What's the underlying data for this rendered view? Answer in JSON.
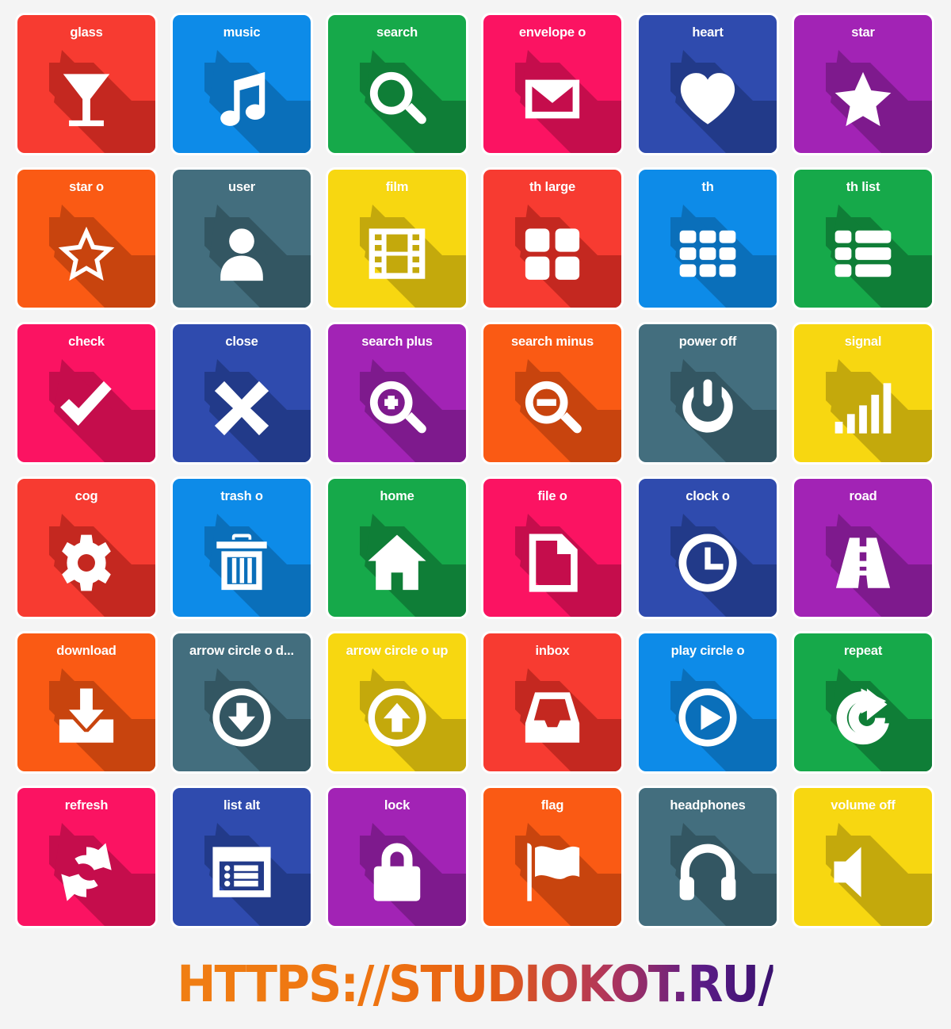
{
  "page": {
    "background": "#f4f4f4",
    "columns": 6,
    "rows": 6,
    "tile_label_color": "#ffffff",
    "tile_icon_color": "#ffffff"
  },
  "footer": {
    "url_text": "HTTPS://STUDIOKOT.RU/",
    "gradient_start": "#F07E13",
    "gradient_end": "#3A1170"
  },
  "tiles": [
    {
      "label": "glass",
      "icon": "glass-icon",
      "color": "#F73B31",
      "shadow": "#C42820"
    },
    {
      "label": "music",
      "icon": "music-icon",
      "color": "#0D8BE8",
      "shadow": "#0A6FBA"
    },
    {
      "label": "search",
      "icon": "search-icon",
      "color": "#16A94A",
      "shadow": "#0F7E37"
    },
    {
      "label": "envelope o",
      "icon": "envelope-open-icon",
      "color": "#FB1362",
      "shadow": "#C50D4C"
    },
    {
      "label": "heart",
      "icon": "heart-icon",
      "color": "#2F4BAE",
      "shadow": "#223A89"
    },
    {
      "label": "star",
      "icon": "star-icon",
      "color": "#A223B5",
      "shadow": "#7E1A8D"
    },
    {
      "label": "star o",
      "icon": "star-outline-icon",
      "color": "#FA5A14",
      "shadow": "#C8440E"
    },
    {
      "label": "user",
      "icon": "user-icon",
      "color": "#436E7E",
      "shadow": "#335662"
    },
    {
      "label": "film",
      "icon": "film-icon",
      "color": "#F7D711",
      "shadow": "#C4A90C"
    },
    {
      "label": "th large",
      "icon": "th-large-icon",
      "color": "#F73B31",
      "shadow": "#C42820"
    },
    {
      "label": "th",
      "icon": "th-icon",
      "color": "#0D8BE8",
      "shadow": "#0A6FBA"
    },
    {
      "label": "th list",
      "icon": "th-list-icon",
      "color": "#16A94A",
      "shadow": "#0F7E37"
    },
    {
      "label": "check",
      "icon": "check-icon",
      "color": "#FB1362",
      "shadow": "#C50D4C"
    },
    {
      "label": "close",
      "icon": "close-icon",
      "color": "#2F4BAE",
      "shadow": "#223A89"
    },
    {
      "label": "search plus",
      "icon": "search-plus-icon",
      "color": "#A223B5",
      "shadow": "#7E1A8D"
    },
    {
      "label": "search minus",
      "icon": "search-minus-icon",
      "color": "#FA5A14",
      "shadow": "#C8440E"
    },
    {
      "label": "power off",
      "icon": "power-off-icon",
      "color": "#436E7E",
      "shadow": "#335662"
    },
    {
      "label": "signal",
      "icon": "signal-icon",
      "color": "#F7D711",
      "shadow": "#C4A90C"
    },
    {
      "label": "cog",
      "icon": "cog-icon",
      "color": "#F73B31",
      "shadow": "#C42820"
    },
    {
      "label": "trash o",
      "icon": "trash-icon",
      "color": "#0D8BE8",
      "shadow": "#0A6FBA"
    },
    {
      "label": "home",
      "icon": "home-icon",
      "color": "#16A94A",
      "shadow": "#0F7E37"
    },
    {
      "label": "file o",
      "icon": "file-icon",
      "color": "#FB1362",
      "shadow": "#C50D4C"
    },
    {
      "label": "clock o",
      "icon": "clock-icon",
      "color": "#2F4BAE",
      "shadow": "#223A89"
    },
    {
      "label": "road",
      "icon": "road-icon",
      "color": "#A223B5",
      "shadow": "#7E1A8D"
    },
    {
      "label": "download",
      "icon": "download-icon",
      "color": "#FA5A14",
      "shadow": "#C8440E"
    },
    {
      "label": "arrow circle o d...",
      "icon": "arrow-circle-down-icon",
      "color": "#436E7E",
      "shadow": "#335662"
    },
    {
      "label": "arrow circle o up",
      "icon": "arrow-circle-up-icon",
      "color": "#F7D711",
      "shadow": "#C4A90C"
    },
    {
      "label": "inbox",
      "icon": "inbox-icon",
      "color": "#F73B31",
      "shadow": "#C42820"
    },
    {
      "label": "play circle o",
      "icon": "play-circle-icon",
      "color": "#0D8BE8",
      "shadow": "#0A6FBA"
    },
    {
      "label": "repeat",
      "icon": "repeat-icon",
      "color": "#16A94A",
      "shadow": "#0F7E37"
    },
    {
      "label": "refresh",
      "icon": "refresh-icon",
      "color": "#FB1362",
      "shadow": "#C50D4C"
    },
    {
      "label": "list alt",
      "icon": "list-alt-icon",
      "color": "#2F4BAE",
      "shadow": "#223A89"
    },
    {
      "label": "lock",
      "icon": "lock-icon",
      "color": "#A223B5",
      "shadow": "#7E1A8D"
    },
    {
      "label": "flag",
      "icon": "flag-icon",
      "color": "#FA5A14",
      "shadow": "#C8440E"
    },
    {
      "label": "headphones",
      "icon": "headphones-icon",
      "color": "#436E7E",
      "shadow": "#335662"
    },
    {
      "label": "volume off",
      "icon": "volume-off-icon",
      "color": "#F7D711",
      "shadow": "#C4A90C"
    }
  ]
}
